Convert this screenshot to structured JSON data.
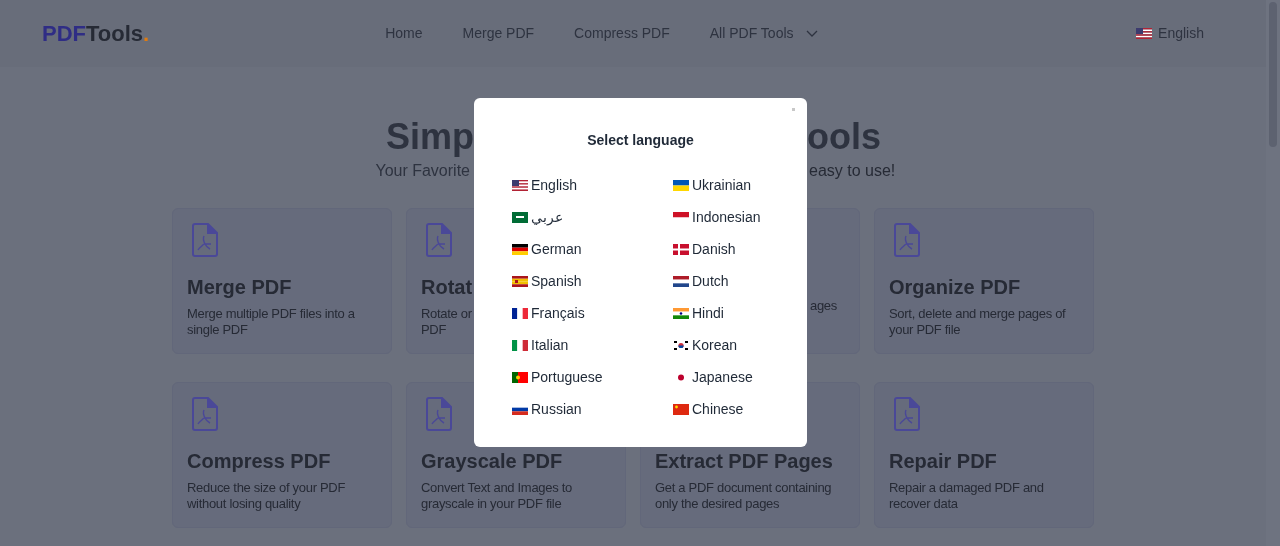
{
  "header": {
    "logo": {
      "brand": "PDF",
      "suffix": "Tools",
      "dot": "."
    },
    "nav": [
      {
        "label": "Home",
        "dropdown": false
      },
      {
        "label": "Merge PDF",
        "dropdown": false
      },
      {
        "label": "Compress PDF",
        "dropdown": false
      },
      {
        "label": "All PDF Tools",
        "dropdown": true
      }
    ],
    "language": "English"
  },
  "hero": {
    "title_left": "Simp",
    "title_right": "ools",
    "subtitle_left": "Your Favorite",
    "subtitle_right": "easy to use!"
  },
  "cards": [
    {
      "kind": "full",
      "icon": true,
      "title": "Merge PDF",
      "description": [
        "Merge multiple PDF files into a",
        "single PDF"
      ]
    },
    {
      "kind": "full",
      "icon": true,
      "title": "Rotat",
      "description": [
        "Rotate or",
        "PDF"
      ]
    },
    {
      "kind": "fragment",
      "description": [
        "ages"
      ]
    },
    {
      "kind": "full",
      "icon": true,
      "title": "Organize PDF",
      "description": [
        "Sort, delete and merge pages of",
        "your PDF file"
      ]
    },
    {
      "kind": "full",
      "icon": true,
      "title": "Compress PDF",
      "description": [
        "Reduce the size of your PDF",
        "without losing quality"
      ]
    },
    {
      "kind": "full",
      "icon": true,
      "title": "Grayscale PDF",
      "description": [
        "Convert Text and Images to",
        "grayscale in your PDF file"
      ]
    },
    {
      "kind": "full",
      "icon": false,
      "title": "Extract PDF Pages",
      "description": [
        "Get a PDF document containing",
        "only the desired pages"
      ]
    },
    {
      "kind": "full",
      "icon": true,
      "title": "Repair PDF",
      "description": [
        "Repair a damaged PDF and",
        "recover data"
      ]
    }
  ],
  "modal": {
    "title": "Select language",
    "languages": [
      {
        "label": "English"
      },
      {
        "label": "Ukrainian"
      },
      {
        "label": "عربي"
      },
      {
        "label": "Indonesian"
      },
      {
        "label": "German"
      },
      {
        "label": "Danish"
      },
      {
        "label": "Spanish"
      },
      {
        "label": "Dutch"
      },
      {
        "label": "Français"
      },
      {
        "label": "Hindi"
      },
      {
        "label": "Italian"
      },
      {
        "label": "Korean"
      },
      {
        "label": "Portuguese"
      },
      {
        "label": "Japanese"
      },
      {
        "label": "Russian"
      },
      {
        "label": "Chinese"
      }
    ]
  }
}
